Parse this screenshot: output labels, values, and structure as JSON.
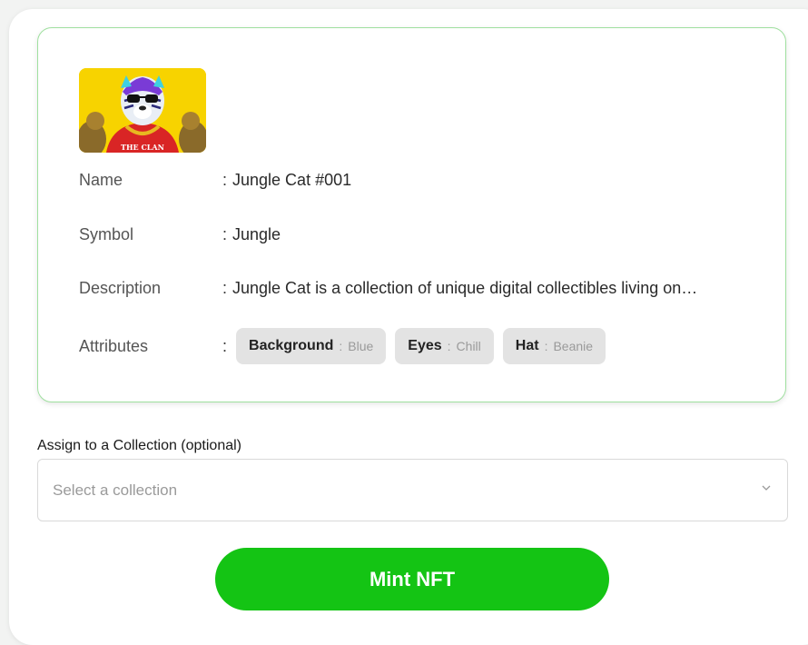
{
  "nft": {
    "image_alt": "Tiger with sunglasses wearing THE CLAN shirt",
    "image_text": "THE CLAN",
    "fields": {
      "name_label": "Name",
      "name_value": "Jungle Cat #001",
      "symbol_label": "Symbol",
      "symbol_value": "Jungle",
      "description_label": "Description",
      "description_value": "Jungle Cat is a collection of unique digital collectibles living on…",
      "attributes_label": "Attributes"
    },
    "separator": ":",
    "attributes": [
      {
        "key": "Background",
        "value": "Blue"
      },
      {
        "key": "Eyes",
        "value": "Chill"
      },
      {
        "key": "Hat",
        "value": "Beanie"
      }
    ]
  },
  "collection": {
    "label": "Assign to a Collection (optional)",
    "placeholder": "Select a collection",
    "chevron_icon": "chevron-down-icon"
  },
  "mint_button": {
    "label": "Mint NFT",
    "color": "#14c414"
  },
  "colors": {
    "card_border": "#9fe09f",
    "chip_bg": "#e3e3e3"
  }
}
